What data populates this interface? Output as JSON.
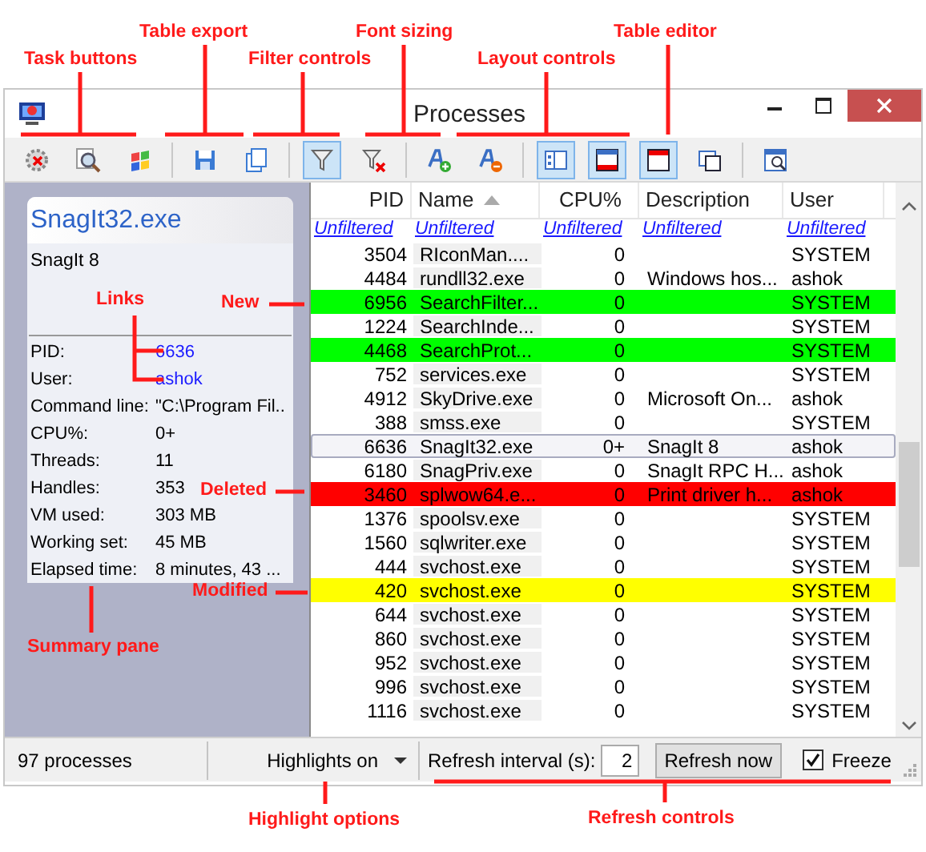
{
  "window": {
    "title": "Processes"
  },
  "toolbar": {
    "groups": [
      [
        {
          "pressed": false
        },
        {
          "pressed": false
        },
        {
          "pressed": false
        }
      ],
      [
        {
          "pressed": false
        },
        {
          "pressed": false
        }
      ],
      [
        {
          "pressed": true
        },
        {
          "pressed": false
        }
      ],
      [
        {
          "pressed": false
        },
        {
          "pressed": false
        }
      ],
      [
        {
          "pressed": true
        },
        {
          "pressed": true
        },
        {
          "pressed": true
        },
        {
          "pressed": false
        }
      ],
      [
        {
          "pressed": false
        }
      ]
    ]
  },
  "summary": {
    "title": "SnagIt32.exe",
    "description": "SnagIt 8",
    "fields": [
      {
        "label": "PID:",
        "value": "6636",
        "kind": "link"
      },
      {
        "label": "User:",
        "value": "ashok",
        "kind": "link"
      },
      {
        "label": "Command line:",
        "value": "\"C:\\Program Fil..",
        "kind": "text"
      },
      {
        "label": "CPU%:",
        "value": "0+",
        "kind": "text"
      },
      {
        "label": "Threads:",
        "value": "11",
        "kind": "text"
      },
      {
        "label": "Handles:",
        "value": "353",
        "kind": "text"
      },
      {
        "label": "VM used:",
        "value": "303 MB",
        "kind": "text"
      },
      {
        "label": "Working set:",
        "value": "45 MB",
        "kind": "text"
      },
      {
        "label": "Elapsed time:",
        "value": "8 minutes, 43 ...",
        "kind": "text"
      }
    ]
  },
  "table": {
    "columns": [
      {
        "label": "PID",
        "sorted": false
      },
      {
        "label": "Name",
        "sorted": true
      },
      {
        "label": "CPU%",
        "sorted": false
      },
      {
        "label": "Description",
        "sorted": false
      },
      {
        "label": "User",
        "sorted": false
      }
    ],
    "filters": [
      "Unfiltered",
      "Unfiltered",
      "Unfiltered",
      "Unfiltered",
      "Unfiltered"
    ],
    "rows": [
      {
        "pid": "3504",
        "name": "RIconMan....",
        "cpu": "0",
        "user": "SYSTEM",
        "kind": "plain",
        "selected": false
      },
      {
        "pid": "4484",
        "name": "rundll32.exe",
        "cpu": "0",
        "description": "Windows hos...",
        "user": "ashok",
        "kind": "plain",
        "selected": false
      },
      {
        "pid": "6956",
        "name": "SearchFilter...",
        "cpu": "0",
        "user": "SYSTEM",
        "kind": "new",
        "selected": false
      },
      {
        "pid": "1224",
        "name": "SearchInde...",
        "cpu": "0",
        "user": "SYSTEM",
        "kind": "plain",
        "selected": false
      },
      {
        "pid": "4468",
        "name": "SearchProt...",
        "cpu": "0",
        "user": "SYSTEM",
        "kind": "new",
        "selected": false
      },
      {
        "pid": "752",
        "name": "services.exe",
        "cpu": "0",
        "user": "SYSTEM",
        "kind": "plain",
        "selected": false
      },
      {
        "pid": "4912",
        "name": "SkyDrive.exe",
        "cpu": "0",
        "description": "Microsoft On...",
        "user": "ashok",
        "kind": "plain",
        "selected": false
      },
      {
        "pid": "388",
        "name": "smss.exe",
        "cpu": "0",
        "user": "SYSTEM",
        "kind": "plain",
        "selected": false
      },
      {
        "pid": "6636",
        "name": "SnagIt32.exe",
        "cpu": "0+",
        "description": "SnagIt 8",
        "user": "ashok",
        "kind": "plain",
        "selected": true
      },
      {
        "pid": "6180",
        "name": "SnagPriv.exe",
        "cpu": "0",
        "description": "SnagIt RPC H...",
        "user": "ashok",
        "kind": "plain",
        "selected": false
      },
      {
        "pid": "3460",
        "name": "splwow64.e...",
        "cpu": "0",
        "description": "Print driver h...",
        "user": "ashok",
        "kind": "deleted",
        "selected": false
      },
      {
        "pid": "1376",
        "name": "spoolsv.exe",
        "cpu": "0",
        "user": "SYSTEM",
        "kind": "plain",
        "selected": false
      },
      {
        "pid": "1560",
        "name": "sqlwriter.exe",
        "cpu": "0",
        "user": "SYSTEM",
        "kind": "plain",
        "selected": false
      },
      {
        "pid": "444",
        "name": "svchost.exe",
        "cpu": "0",
        "user": "SYSTEM",
        "kind": "plain",
        "selected": false
      },
      {
        "pid": "420",
        "name": "svchost.exe",
        "cpu": "0",
        "user": "SYSTEM",
        "kind": "modified",
        "selected": false
      },
      {
        "pid": "644",
        "name": "svchost.exe",
        "cpu": "0",
        "user": "SYSTEM",
        "kind": "plain",
        "selected": false
      },
      {
        "pid": "860",
        "name": "svchost.exe",
        "cpu": "0",
        "user": "SYSTEM",
        "kind": "plain",
        "selected": false
      },
      {
        "pid": "952",
        "name": "svchost.exe",
        "cpu": "0",
        "user": "SYSTEM",
        "kind": "plain",
        "selected": false
      },
      {
        "pid": "996",
        "name": "svchost.exe",
        "cpu": "0",
        "user": "SYSTEM",
        "kind": "plain",
        "selected": false
      },
      {
        "pid": "1116",
        "name": "svchost.exe",
        "cpu": "0",
        "user": "SYSTEM",
        "kind": "plain",
        "selected": false
      }
    ]
  },
  "status_bar": {
    "count": "97 processes",
    "highlights": "Highlights on",
    "refresh_label": "Refresh interval (s):",
    "refresh_interval": "2",
    "refresh_button": "Refresh now",
    "freeze": {
      "label": "Freeze",
      "checked": true
    }
  },
  "annotations": [
    {
      "label": "Table export"
    },
    {
      "label": "Font sizing"
    },
    {
      "label": "Table editor"
    },
    {
      "label": "Task buttons"
    },
    {
      "label": "Filter controls"
    },
    {
      "label": "Layout controls"
    },
    {
      "label": "Links"
    },
    {
      "label": "New"
    },
    {
      "label": "Deleted"
    },
    {
      "label": "Modified"
    },
    {
      "label": "Summary pane"
    },
    {
      "label": "Highlight options"
    },
    {
      "label": "Refresh controls"
    }
  ]
}
